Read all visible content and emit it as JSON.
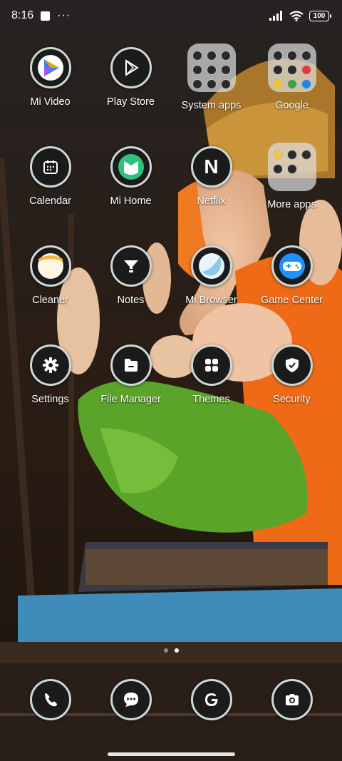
{
  "status_bar": {
    "time": "8:16",
    "battery": "100",
    "icons": [
      "screenshot-icon",
      "more-dots-icon",
      "signal-icon",
      "wifi-icon",
      "battery-icon"
    ]
  },
  "home": {
    "rows": [
      [
        {
          "label": "Mi Video",
          "icon": "mi-video-icon"
        },
        {
          "label": "Play Store",
          "icon": "play-store-icon"
        },
        {
          "label": "System apps",
          "icon": "folder-icon"
        },
        {
          "label": "Google",
          "icon": "folder-icon"
        }
      ],
      [
        {
          "label": "Calendar",
          "icon": "calendar-icon"
        },
        {
          "label": "Mi Home",
          "icon": "mi-home-icon"
        },
        {
          "label": "Netflix",
          "icon": "netflix-icon"
        },
        {
          "label": "More apps",
          "icon": "folder-icon"
        }
      ],
      [
        {
          "label": "Cleaner",
          "icon": "cleaner-icon"
        },
        {
          "label": "Notes",
          "icon": "notes-icon"
        },
        {
          "label": "Mi Browser",
          "icon": "browser-icon"
        },
        {
          "label": "Game Center",
          "icon": "game-controller-icon"
        }
      ],
      [
        {
          "label": "Settings",
          "icon": "gear-icon"
        },
        {
          "label": "File Manager",
          "icon": "file-manager-icon"
        },
        {
          "label": "Themes",
          "icon": "themes-icon"
        },
        {
          "label": "Security",
          "icon": "shield-icon"
        }
      ]
    ]
  },
  "page_indicator": {
    "pages": 2,
    "current": 2
  },
  "dock": [
    "phone-icon",
    "messages-icon",
    "google-icon",
    "camera-icon"
  ],
  "netflix_letter": "N",
  "colors": {
    "icon_bg": "#1b1b1b",
    "icon_ring": "#cfd8d4",
    "accent_mihome": "#2ec27e",
    "accent_game": "#1e90ff"
  }
}
